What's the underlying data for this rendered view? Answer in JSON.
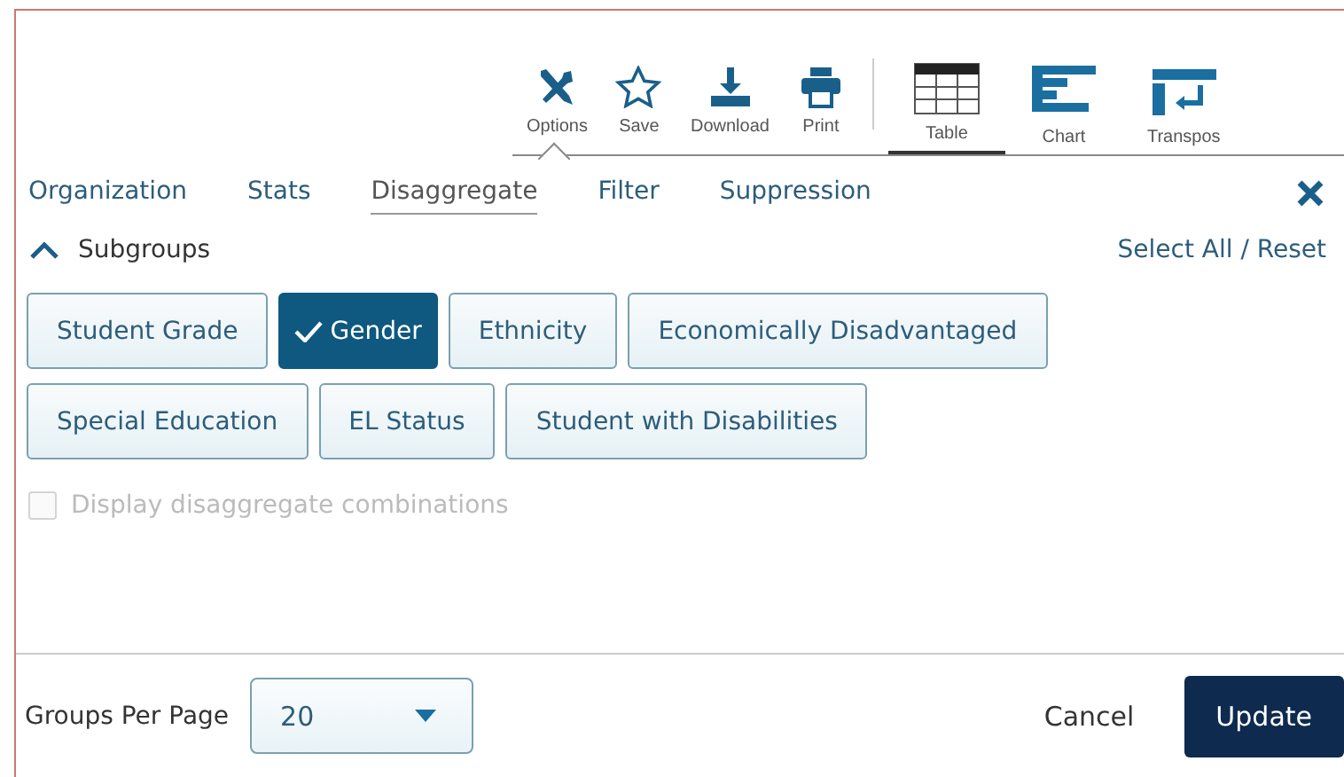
{
  "toolbar": {
    "actions": [
      {
        "label": "Options",
        "kind": "options",
        "selected": true
      },
      {
        "label": "Save",
        "kind": "save",
        "selected": false
      },
      {
        "label": "Download",
        "kind": "download",
        "selected": false
      },
      {
        "label": "Print",
        "kind": "print",
        "selected": false
      }
    ],
    "views": [
      {
        "label": "Table",
        "kind": "table",
        "selected": true
      },
      {
        "label": "Chart",
        "kind": "chart",
        "selected": false
      },
      {
        "label": "Transpos",
        "kind": "transpose",
        "selected": false
      }
    ]
  },
  "tabs": [
    {
      "label": "Organization",
      "selected": false
    },
    {
      "label": "Stats",
      "selected": false
    },
    {
      "label": "Disaggregate",
      "selected": true
    },
    {
      "label": "Filter",
      "selected": false
    },
    {
      "label": "Suppression",
      "selected": false
    }
  ],
  "section": {
    "title": "Subgroups",
    "expanded": true,
    "link": "Select All / Reset"
  },
  "subgroups": [
    {
      "label": "Student Grade",
      "selected": false
    },
    {
      "label": "Gender",
      "selected": true
    },
    {
      "label": "Ethnicity",
      "selected": false
    },
    {
      "label": "Economically Disadvantaged",
      "selected": false
    },
    {
      "label": "Special Education",
      "selected": false
    },
    {
      "label": "EL Status",
      "selected": false
    },
    {
      "label": "Student with Disabilities",
      "selected": false
    }
  ],
  "combinations": {
    "label": "Display disaggregate combinations",
    "checked": false,
    "disabled": true
  },
  "footer": {
    "groups_label": "Groups Per Page",
    "groups_value": "20",
    "cancel": "Cancel",
    "update": "Update"
  }
}
